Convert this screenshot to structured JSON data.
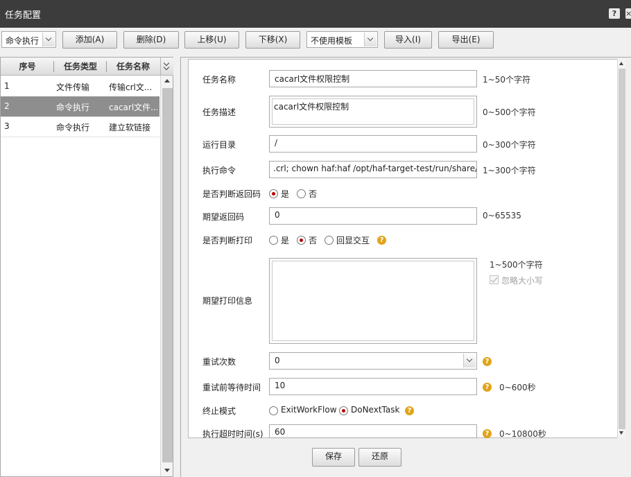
{
  "window": {
    "title": "任务配置",
    "help_glyph": "?",
    "close_glyph": "×"
  },
  "toolbar": {
    "task_type_select": "命令执行",
    "add_label": "添加(A)",
    "delete_label": "删除(D)",
    "move_up_label": "上移(U)",
    "move_down_label": "下移(X)",
    "template_select": "不使用模板",
    "import_label": "导入(I)",
    "export_label": "导出(E)"
  },
  "task_table": {
    "columns": [
      "序号",
      "任务类型",
      "任务名称"
    ],
    "rows": [
      {
        "index": "1",
        "type": "文件传输",
        "name": "传输crl文..."
      },
      {
        "index": "2",
        "type": "命令执行",
        "name": "cacarl文件..."
      },
      {
        "index": "3",
        "type": "命令执行",
        "name": "建立软链接"
      }
    ]
  },
  "form": {
    "task_name": {
      "label": "任务名称",
      "value": "cacarl文件权限控制",
      "hint": "1~50个字符"
    },
    "task_desc": {
      "label": "任务描述",
      "value": "cacarl文件权限控制",
      "hint": "0~500个字符"
    },
    "run_dir": {
      "label": "运行目录",
      "value": "/",
      "hint": "0~300个字符"
    },
    "command": {
      "label": "执行命令",
      "value": ".crl; chown haf:haf  /opt/haf-target-test/run/share/ca.crl",
      "hint": "1~300个字符"
    },
    "check_return": {
      "label": "是否判断返回码",
      "yes": "是",
      "no": "否"
    },
    "expected_return": {
      "label": "期望返回码",
      "value": "0",
      "hint": "0~65535"
    },
    "check_print": {
      "label": "是否判断打印",
      "yes": "是",
      "no": "否",
      "echo": "回显交互"
    },
    "expected_print": {
      "label": "期望打印信息",
      "value": "",
      "hint": "1~500个字符",
      "ignore_case": "忽略大小写"
    },
    "retry_count": {
      "label": "重试次数",
      "value": "0"
    },
    "retry_wait": {
      "label": "重试前等待时间",
      "value": "10",
      "hint": "0~600秒"
    },
    "stop_mode": {
      "label": "终止模式",
      "opt1": "ExitWorkFlow",
      "opt2": "DoNextTask"
    },
    "timeout": {
      "label": "执行超时时间(s)",
      "value": "60",
      "hint": "0~10800秒"
    }
  },
  "actions": {
    "save_label": "保存",
    "restore_label": "还原"
  },
  "colors": {
    "titlebar": "#3c3c3c",
    "selected_row": "#8e8e8e",
    "radio_dot": "#bb0000",
    "help_icon": "#e0a41a"
  },
  "help_icon_glyph": "?"
}
